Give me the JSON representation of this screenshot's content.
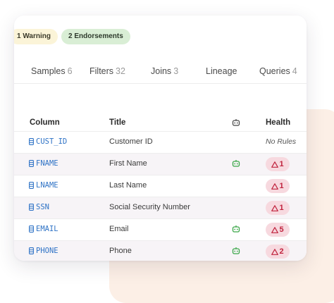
{
  "badges": {
    "warning": "1 Warning",
    "endorsements": "2 Endorsements"
  },
  "tabs": [
    {
      "label": "Samples",
      "count": "6"
    },
    {
      "label": "Filters",
      "count": "32"
    },
    {
      "label": "Joins",
      "count": "3"
    },
    {
      "label": "Lineage",
      "count": ""
    },
    {
      "label": "Queries",
      "count": "4"
    }
  ],
  "table": {
    "headers": {
      "column": "Column",
      "title": "Title",
      "ai_icon": "robot-icon",
      "health": "Health"
    },
    "rows": [
      {
        "column": "CUST_ID",
        "title": "Customer ID",
        "ai": false,
        "health": "No Rules"
      },
      {
        "column": "FNAME",
        "title": "First Name",
        "ai": true,
        "health": "1"
      },
      {
        "column": "LNAME",
        "title": "Last Name",
        "ai": false,
        "health": "1"
      },
      {
        "column": "SSN",
        "title": "Social Security Number",
        "ai": false,
        "health": "1"
      },
      {
        "column": "EMAIL",
        "title": "Email",
        "ai": true,
        "health": "5"
      },
      {
        "column": "PHONE",
        "title": "Phone",
        "ai": true,
        "health": "2"
      }
    ]
  },
  "colors": {
    "column_link": "#2f73c6",
    "ai_green": "#3aa648",
    "health_red": "#c0223d",
    "health_bg": "#f7d9df",
    "backdrop": "#fcefe6"
  }
}
